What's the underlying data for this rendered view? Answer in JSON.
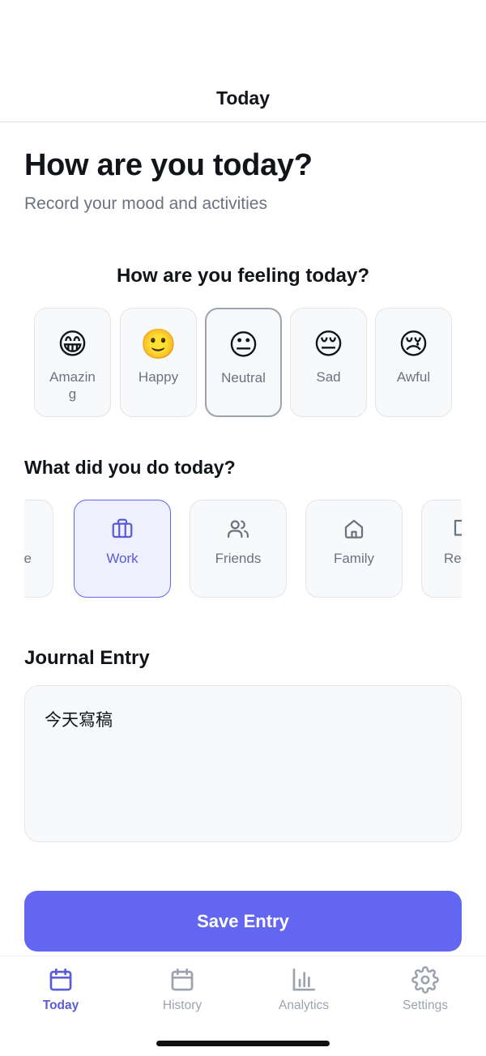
{
  "nav": {
    "title": "Today"
  },
  "header": {
    "title": "How are you today?",
    "subtitle": "Record your mood and activities"
  },
  "mood": {
    "question": "How are you feeling today?",
    "selected": "Neutral",
    "options": [
      {
        "emoji": "😁",
        "label": "Amazing"
      },
      {
        "emoji": "🙂",
        "label": "Happy"
      },
      {
        "emoji": "😐",
        "label": "Neutral"
      },
      {
        "emoji": "😔",
        "label": "Sad"
      },
      {
        "emoji": "😢",
        "label": "Awful"
      }
    ]
  },
  "activities": {
    "question": "What did you do today?",
    "selected": "Work",
    "items": [
      {
        "label": "e",
        "icon": "partial-icon"
      },
      {
        "label": "Work",
        "icon": "briefcase-icon"
      },
      {
        "label": "Friends",
        "icon": "users-icon"
      },
      {
        "label": "Family",
        "icon": "home-icon"
      },
      {
        "label": "Re",
        "icon": "partial-icon"
      }
    ]
  },
  "journal": {
    "heading": "Journal Entry",
    "value": "今天寫稿"
  },
  "save_button": {
    "label": "Save Entry"
  },
  "tabbar": {
    "active": "Today",
    "tabs": [
      {
        "label": "Today",
        "icon": "calendar-icon"
      },
      {
        "label": "History",
        "icon": "calendar-icon"
      },
      {
        "label": "Analytics",
        "icon": "bar-chart-icon"
      },
      {
        "label": "Settings",
        "icon": "gear-icon"
      }
    ]
  },
  "colors": {
    "accent": "#6366f1",
    "accent_text": "#5b5bd6",
    "muted_text": "#6b7280",
    "card_bg": "#f8f9fb",
    "card_border": "#e3e5ea"
  }
}
